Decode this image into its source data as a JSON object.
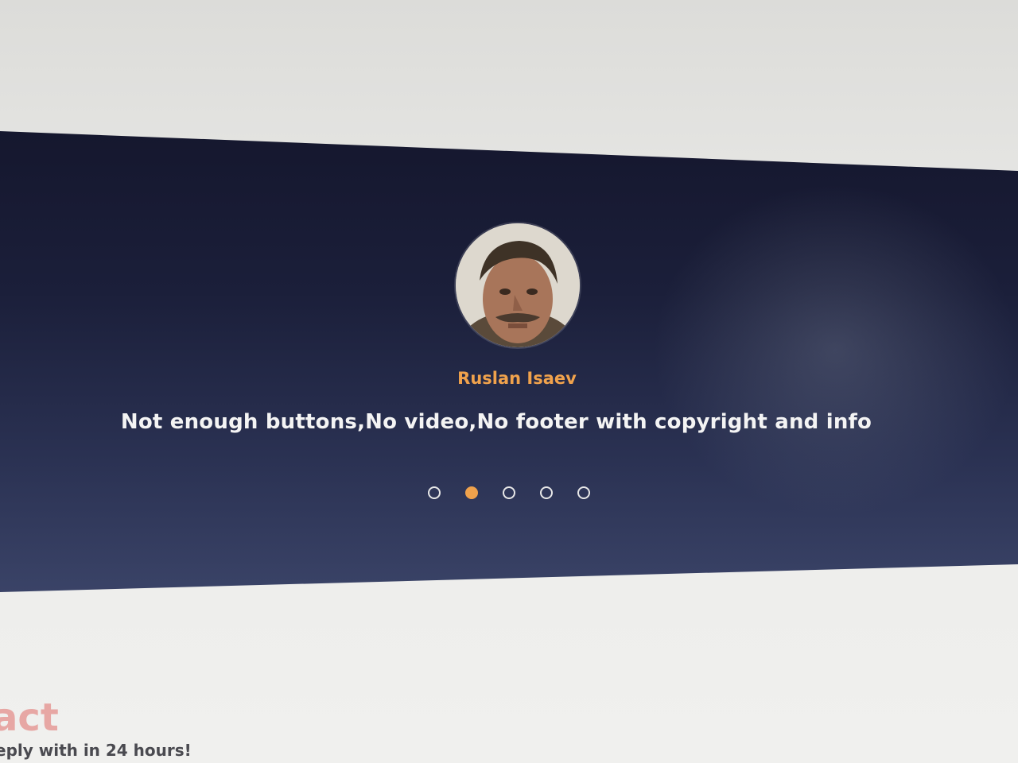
{
  "testimonial": {
    "author": "Ruslan Isaev",
    "quote": "Not enough buttons,No video,No footer with copyright and info",
    "slides_total": 5,
    "active_slide": 2
  },
  "contact": {
    "title_partial": "act",
    "subtitle_partial": "eply with in 24 hours!"
  },
  "colors": {
    "accent": "#f0a24c",
    "band": "#1b1f3a",
    "text": "#f4f4f4",
    "contact_title": "#e7a7a4"
  }
}
